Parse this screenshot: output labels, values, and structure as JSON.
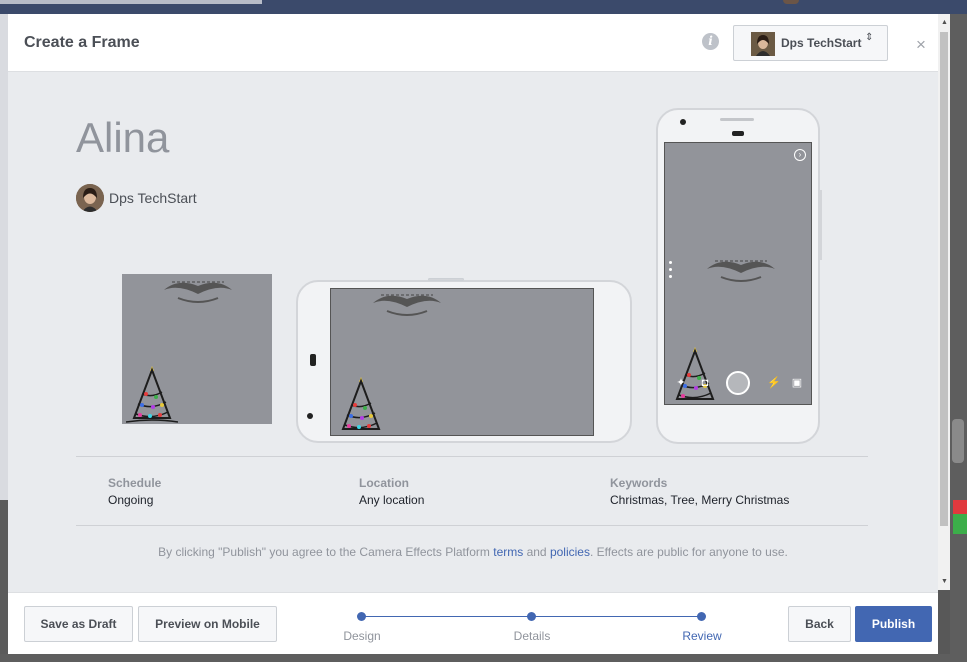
{
  "dialog": {
    "title": "Create a Frame",
    "page_selector": {
      "label": "Dps TechStart",
      "caret": "⇕"
    },
    "info_icon": "i",
    "close_icon": "×"
  },
  "frame": {
    "name": "Alina",
    "creator": "Dps TechStart"
  },
  "details": {
    "schedule_label": "Schedule",
    "schedule_value": "Ongoing",
    "location_label": "Location",
    "location_value": "Any location",
    "keywords_label": "Keywords",
    "keywords_value": "Christmas, Tree, Merry Christmas"
  },
  "terms": {
    "prefix": "By clicking \"Publish\" you agree to the Camera Effects Platform ",
    "terms_link": "terms",
    "and": " and ",
    "policies_link": "policies",
    "suffix": ". Effects are public for anyone to use."
  },
  "footer": {
    "save_draft": "Save as Draft",
    "preview_mobile": "Preview on Mobile",
    "back": "Back",
    "publish": "Publish",
    "steps": [
      {
        "label": "Design",
        "active": false
      },
      {
        "label": "Details",
        "active": false
      },
      {
        "label": "Review",
        "active": true
      }
    ]
  },
  "colors": {
    "primary": "#4267b2",
    "preview_gray": "#92949a"
  },
  "icons": {
    "info": "info-icon",
    "close": "close-icon",
    "next": "chevron-right-circle-icon",
    "shutter": "shutter-icon",
    "effects": "effects-icon",
    "gallery": "gallery-icon"
  }
}
